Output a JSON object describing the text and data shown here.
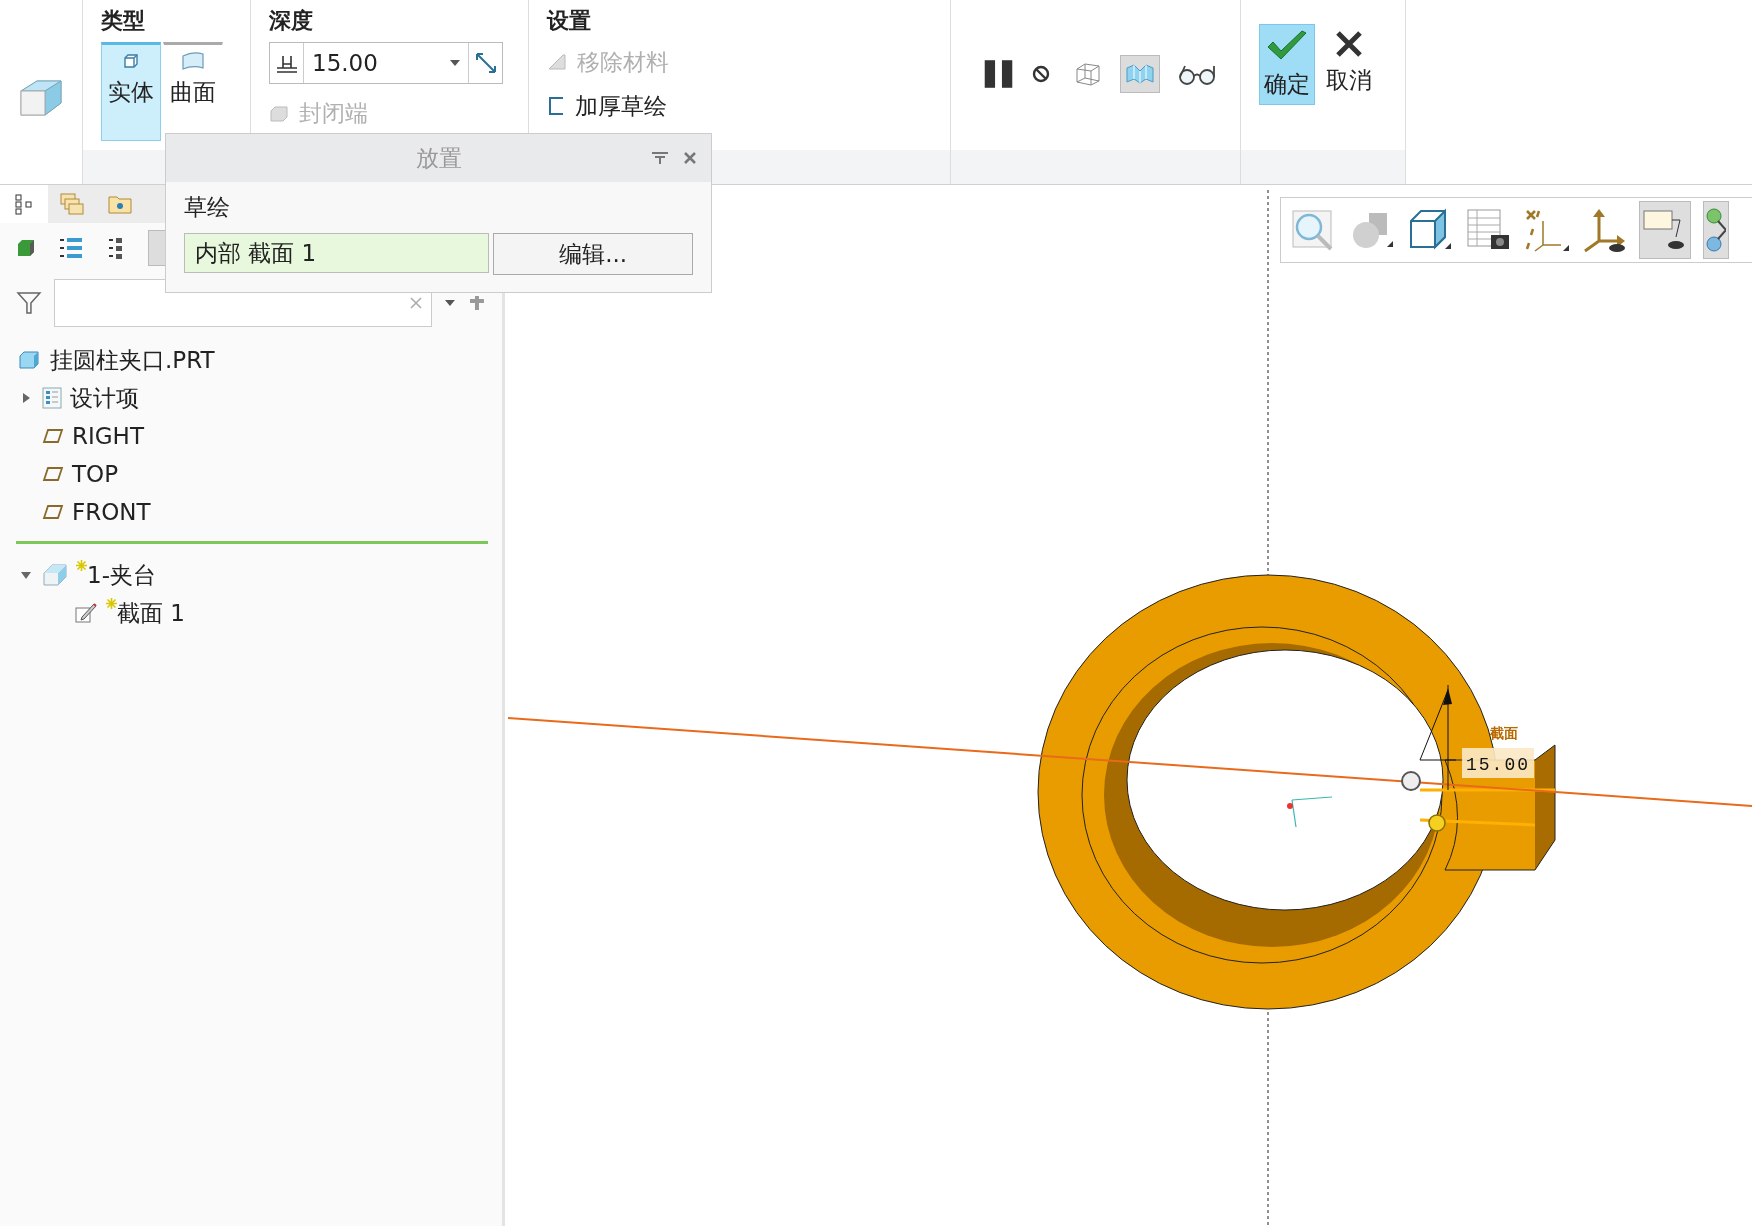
{
  "type_group": {
    "title": "类型",
    "options": [
      {
        "label": "实体",
        "selected": true
      },
      {
        "label": "曲面",
        "selected": false
      }
    ]
  },
  "depth_group": {
    "title": "深度",
    "value": "15.00",
    "capped_ends": {
      "label": "封闭端",
      "disabled": true
    }
  },
  "settings_group": {
    "title": "设置",
    "options": [
      {
        "label": "移除材料",
        "disabled": true
      },
      {
        "label": "加厚草绘",
        "disabled": false
      }
    ]
  },
  "view_toggles": [
    {
      "selected": false
    },
    {
      "selected": false
    },
    {
      "selected": true
    },
    {
      "selected": false
    }
  ],
  "confirm": {
    "ok": "确定",
    "cancel": "取消"
  },
  "placement_panel": {
    "title": "放置",
    "sketch_label": "草绘",
    "sketch_value": "内部 截面 1",
    "edit_button": "编辑..."
  },
  "model_tree": {
    "root": "挂圆柱夹口.PRT",
    "items": [
      {
        "label": "设计项",
        "kind": "folder",
        "expanded": false
      },
      {
        "label": "RIGHT",
        "kind": "plane"
      },
      {
        "label": "TOP",
        "kind": "plane"
      },
      {
        "label": "FRONT",
        "kind": "plane"
      }
    ],
    "features": [
      {
        "label": "1-夹台",
        "new": true,
        "expanded": true,
        "children": [
          {
            "label": "截面 1",
            "new": true
          }
        ]
      }
    ]
  },
  "viewport": {
    "dimension": {
      "label": "截面",
      "value": "15.00"
    }
  }
}
